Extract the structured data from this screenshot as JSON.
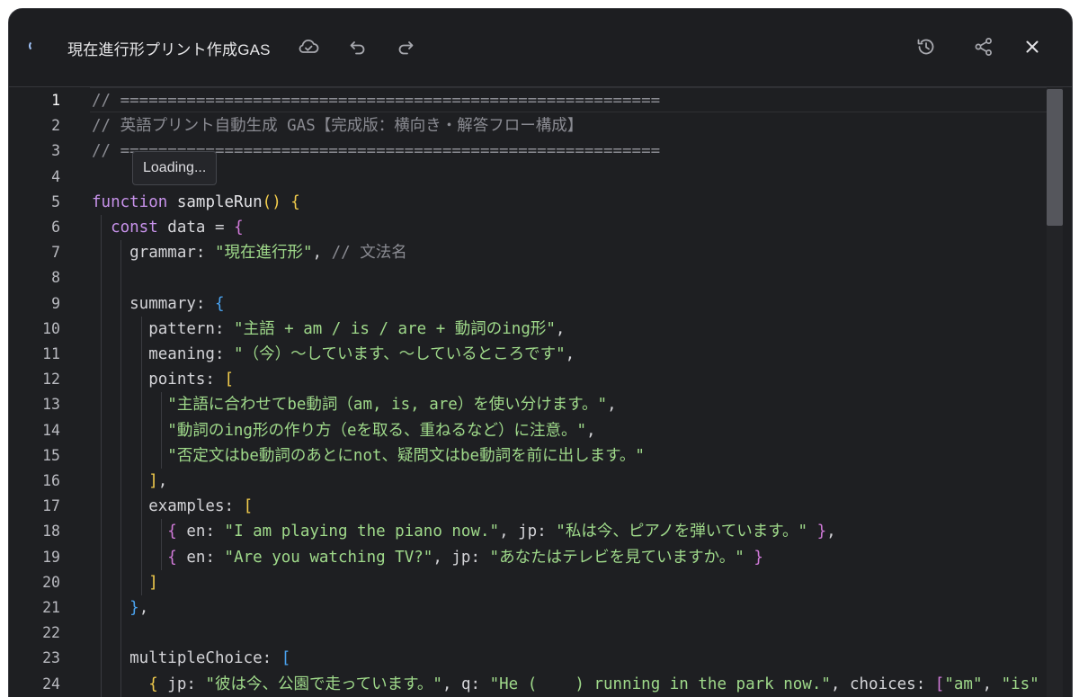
{
  "header": {
    "title": "現在進行形プリント作成GAS",
    "icons": {
      "loading": "loading-spinner-icon",
      "cloud": "cloud-sync-icon",
      "undo": "undo-icon",
      "redo": "redo-icon",
      "history": "history-icon",
      "share": "share-icon",
      "close": "close-icon"
    }
  },
  "tooltip": {
    "text": "Loading..."
  },
  "editor": {
    "active_line": 1,
    "line_numbers": [
      "1",
      "2",
      "3",
      "4",
      "5",
      "6",
      "7",
      "8",
      "9",
      "10",
      "11",
      "12",
      "13",
      "14",
      "15",
      "16",
      "17",
      "18",
      "19",
      "20",
      "21",
      "22",
      "23",
      "24"
    ],
    "lines": [
      [
        [
          "comment",
          "// ========================================================="
        ]
      ],
      [
        [
          "comment",
          "// 英語プリント自動生成 GAS【完成版：横向き・解答フロー構成】"
        ]
      ],
      [
        [
          "comment",
          "// ========================================================="
        ]
      ],
      [],
      [
        [
          "kw",
          "function"
        ],
        [
          "plain",
          " "
        ],
        [
          "fn",
          "sampleRun"
        ],
        [
          "b1",
          "()"
        ],
        [
          "plain",
          " "
        ],
        [
          "b1",
          "{"
        ]
      ],
      [
        [
          "plain",
          "  "
        ],
        [
          "kw",
          "const"
        ],
        [
          "plain",
          " data = "
        ],
        [
          "b2",
          "{"
        ]
      ],
      [
        [
          "plain",
          "    grammar: "
        ],
        [
          "str",
          "\"現在進行形\""
        ],
        [
          "plain",
          ", "
        ],
        [
          "comment",
          "// 文法名"
        ]
      ],
      [],
      [
        [
          "plain",
          "    summary: "
        ],
        [
          "b3",
          "{"
        ]
      ],
      [
        [
          "plain",
          "      pattern: "
        ],
        [
          "str",
          "\"主語 + am / is / are + 動詞のing形\""
        ],
        [
          "plain",
          ","
        ]
      ],
      [
        [
          "plain",
          "      meaning: "
        ],
        [
          "str",
          "\"（今）～しています、～しているところです\""
        ],
        [
          "plain",
          ","
        ]
      ],
      [
        [
          "plain",
          "      points: "
        ],
        [
          "b1",
          "["
        ]
      ],
      [
        [
          "plain",
          "        "
        ],
        [
          "str",
          "\"主語に合わせてbe動詞（am, is, are）を使い分けます。\""
        ],
        [
          "plain",
          ","
        ]
      ],
      [
        [
          "plain",
          "        "
        ],
        [
          "str",
          "\"動詞のing形の作り方（eを取る、重ねるなど）に注意。\""
        ],
        [
          "plain",
          ","
        ]
      ],
      [
        [
          "plain",
          "        "
        ],
        [
          "str",
          "\"否定文はbe動詞のあとにnot、疑問文はbe動詞を前に出します。\""
        ]
      ],
      [
        [
          "plain",
          "      "
        ],
        [
          "b1",
          "]"
        ],
        [
          "plain",
          ","
        ]
      ],
      [
        [
          "plain",
          "      examples: "
        ],
        [
          "b1",
          "["
        ]
      ],
      [
        [
          "plain",
          "        "
        ],
        [
          "b2",
          "{"
        ],
        [
          "plain",
          " en: "
        ],
        [
          "str",
          "\"I am playing the piano now.\""
        ],
        [
          "plain",
          ", jp: "
        ],
        [
          "str",
          "\"私は今、ピアノを弾いています。\""
        ],
        [
          "plain",
          " "
        ],
        [
          "b2",
          "}"
        ],
        [
          "plain",
          ","
        ]
      ],
      [
        [
          "plain",
          "        "
        ],
        [
          "b2",
          "{"
        ],
        [
          "plain",
          " en: "
        ],
        [
          "str",
          "\"Are you watching TV?\""
        ],
        [
          "plain",
          ", jp: "
        ],
        [
          "str",
          "\"あなたはテレビを見ていますか。\""
        ],
        [
          "plain",
          " "
        ],
        [
          "b2",
          "}"
        ]
      ],
      [
        [
          "plain",
          "      "
        ],
        [
          "b1",
          "]"
        ]
      ],
      [
        [
          "plain",
          "    "
        ],
        [
          "b3",
          "}"
        ],
        [
          "plain",
          ","
        ]
      ],
      [],
      [
        [
          "plain",
          "    multipleChoice: "
        ],
        [
          "b3",
          "["
        ]
      ],
      [
        [
          "plain",
          "      "
        ],
        [
          "b1",
          "{"
        ],
        [
          "plain",
          " jp: "
        ],
        [
          "str",
          "\"彼は今、公園で走っています。\""
        ],
        [
          "plain",
          ", q: "
        ],
        [
          "str",
          "\"He (    ) running in the park now.\""
        ],
        [
          "plain",
          ", choices: "
        ],
        [
          "b2",
          "["
        ],
        [
          "str",
          "\"am\""
        ],
        [
          "plain",
          ", "
        ],
        [
          "str",
          "\"is\""
        ]
      ]
    ]
  }
}
